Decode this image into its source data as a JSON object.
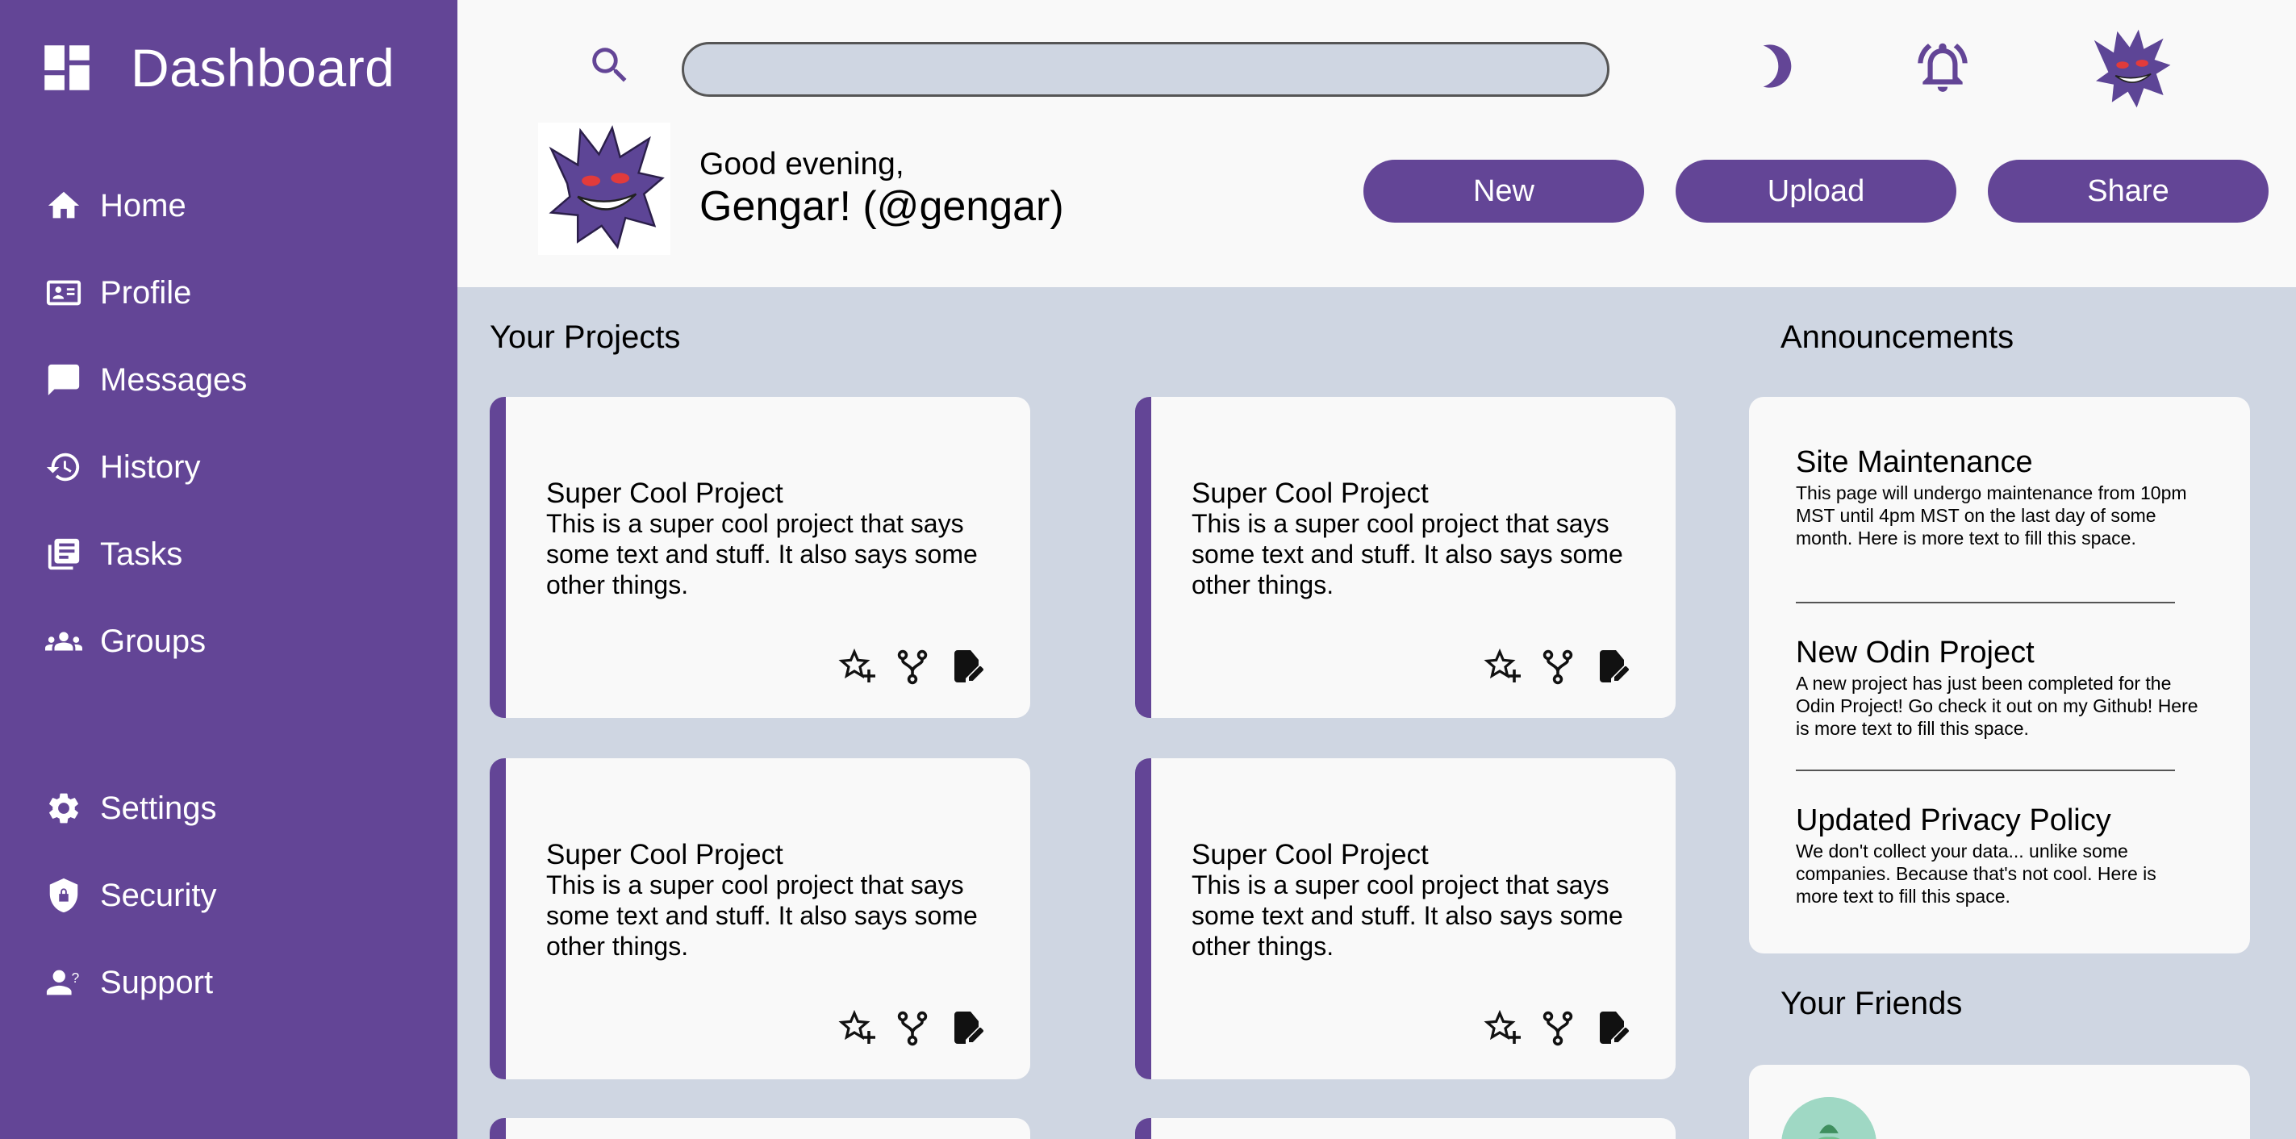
{
  "app": {
    "title": "Dashboard",
    "accent_color": "#634596",
    "background_color": "#cfd6e2",
    "surface_color": "#f9f9f9"
  },
  "sidebar": {
    "main_nav": [
      {
        "label": "Home",
        "icon": "home-icon"
      },
      {
        "label": "Profile",
        "icon": "profile-card-icon"
      },
      {
        "label": "Messages",
        "icon": "message-icon"
      },
      {
        "label": "History",
        "icon": "history-icon"
      },
      {
        "label": "Tasks",
        "icon": "tasks-icon"
      },
      {
        "label": "Groups",
        "icon": "groups-icon"
      }
    ],
    "secondary_nav": [
      {
        "label": "Settings",
        "icon": "gear-icon"
      },
      {
        "label": "Security",
        "icon": "shield-icon"
      },
      {
        "label": "Support",
        "icon": "support-icon"
      }
    ]
  },
  "header": {
    "search_placeholder": "",
    "greeting": "Good evening,",
    "username": "Gengar! (@gengar)",
    "actions": [
      "New",
      "Upload",
      "Share"
    ]
  },
  "projects": {
    "title": "Your Projects",
    "items": [
      {
        "title": "Super Cool Project",
        "description": "This is a super cool project that says some text and stuff. It also says some other things."
      },
      {
        "title": "Super Cool Project",
        "description": "This is a super cool project that says some text and stuff. It also says some other things."
      },
      {
        "title": "Super Cool Project",
        "description": "This is a super cool project that says some text and stuff. It also says some other things."
      },
      {
        "title": "Super Cool Project",
        "description": "This is a super cool project that says some text and stuff. It also says some other things."
      }
    ]
  },
  "announcements": {
    "title": "Announcements",
    "items": [
      {
        "title": "Site Maintenance",
        "body": "This page will undergo maintenance from 10pm MST until 4pm MST on the last day of some month. Here is more text to fill this space."
      },
      {
        "title": "New Odin Project",
        "body": "A new project has just been completed for the Odin Project! Go check it out on my Github! Here is more text to fill this space."
      },
      {
        "title": "Updated Privacy Policy",
        "body": "We don't collect your data... unlike some companies. Because that's not cool. Here is more text to fill this space."
      }
    ]
  },
  "friends": {
    "title": "Your Friends"
  }
}
